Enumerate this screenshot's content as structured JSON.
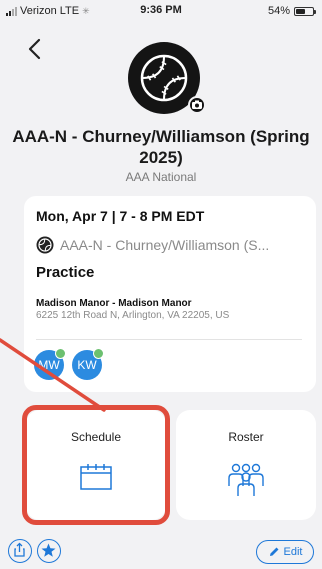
{
  "status_bar": {
    "carrier": "Verizon",
    "network": "LTE",
    "time": "9:36 PM",
    "battery_level": "54%",
    "battery_fraction": 0.54
  },
  "team": {
    "name": "AAA-N - Churney/Williamson (Spring 2025)",
    "division": "AAA National",
    "logo_icon": "baseball-icon"
  },
  "event": {
    "datetime": "Mon, Apr 7 | 7 - 8 PM EDT",
    "team_name": "AAA-N - Churney/Williamson (S...",
    "type": "Practice",
    "venue": "Madison Manor - Madison Manor",
    "address": "6225 12th Road N, Arlington, VA 22205, US",
    "attendees": [
      {
        "initials": "MW",
        "confirmed": true
      },
      {
        "initials": "KW",
        "confirmed": true
      }
    ]
  },
  "tiles": {
    "schedule_label": "Schedule",
    "roster_label": "Roster"
  },
  "toolbar": {
    "edit_label": "Edit"
  },
  "colors": {
    "accent": "#1e78d8",
    "highlight": "#e04c3c",
    "avatar": "#2c8be0",
    "check": "#6cc070"
  }
}
